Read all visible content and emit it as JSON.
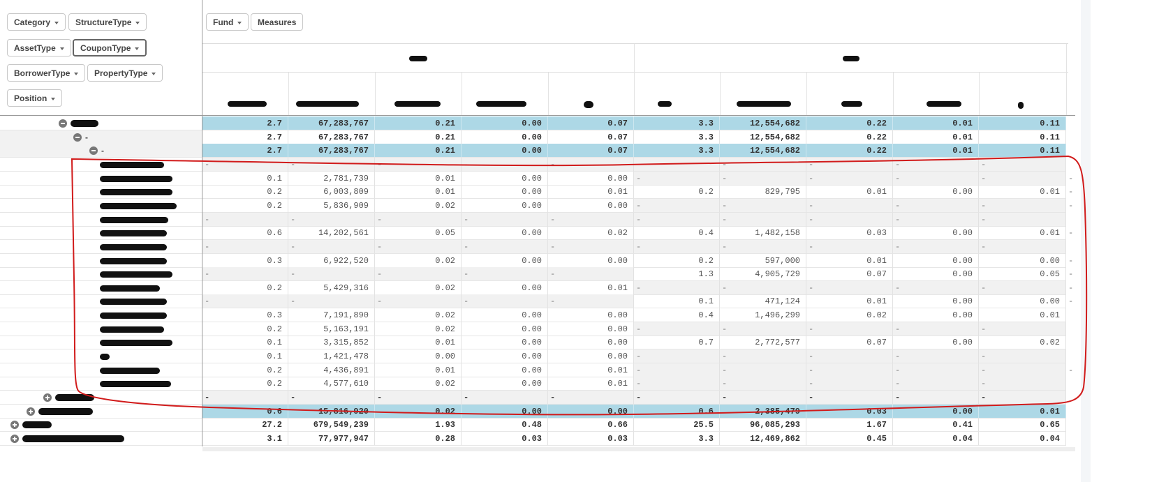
{
  "dimension_chips": [
    {
      "label": "Category"
    },
    {
      "label": "StructureType"
    },
    {
      "label": "AssetType"
    },
    {
      "label": "CouponType",
      "active": true
    },
    {
      "label": "BorrowerType"
    },
    {
      "label": "PropertyType"
    },
    {
      "label": "Position"
    }
  ],
  "column_chips": [
    {
      "label": "Fund",
      "dropdown": true
    },
    {
      "label": "Measures",
      "dropdown": false
    }
  ],
  "colors": {
    "highlight_row": "#add8e6",
    "null_cell": "#f1f1f1",
    "annotation": "#d11b1b"
  },
  "rows": [
    {
      "level": 1,
      "icon": "minus",
      "label": "",
      "style": "hl bold",
      "a": [
        "2.7",
        "67,283,767",
        "0.21",
        "0.00",
        "0.07"
      ],
      "b": [
        "3.3",
        "12,554,682",
        "0.22",
        "0.01",
        "0.11"
      ]
    },
    {
      "level": 2,
      "icon": "minus",
      "label": "-",
      "style": "bold",
      "a": [
        "2.7",
        "67,283,767",
        "0.21",
        "0.00",
        "0.07"
      ],
      "b": [
        "3.3",
        "12,554,682",
        "0.22",
        "0.01",
        "0.11"
      ]
    },
    {
      "level": 3,
      "icon": "minus",
      "label": "-",
      "style": "hl bold",
      "a": [
        "2.7",
        "67,283,767",
        "0.21",
        "0.00",
        "0.07"
      ],
      "b": [
        "3.3",
        "12,554,682",
        "0.22",
        "0.01",
        "0.11"
      ]
    },
    {
      "level": 4,
      "label": "",
      "a": null,
      "b": null,
      "extra": ""
    },
    {
      "level": 4,
      "label": "",
      "a": [
        "0.1",
        "2,781,739",
        "0.01",
        "0.00",
        "0.00"
      ],
      "b": null,
      "extra": "-"
    },
    {
      "level": 4,
      "label": "",
      "a": [
        "0.2",
        "6,003,809",
        "0.01",
        "0.00",
        "0.01"
      ],
      "b": [
        "0.2",
        "829,795",
        "0.01",
        "0.00",
        "0.01"
      ],
      "extra": "-"
    },
    {
      "level": 4,
      "label": "",
      "a": [
        "0.2",
        "5,836,909",
        "0.02",
        "0.00",
        "0.00"
      ],
      "b": null,
      "extra": "-"
    },
    {
      "level": 4,
      "label": "",
      "a": null,
      "b": null,
      "extra": ""
    },
    {
      "level": 4,
      "label": "",
      "a": [
        "0.6",
        "14,202,561",
        "0.05",
        "0.00",
        "0.02"
      ],
      "b": [
        "0.4",
        "1,482,158",
        "0.03",
        "0.00",
        "0.01"
      ],
      "extra": "-"
    },
    {
      "level": 4,
      "label": "",
      "a": null,
      "b": null,
      "extra": ""
    },
    {
      "level": 4,
      "label": "",
      "a": [
        "0.3",
        "6,922,520",
        "0.02",
        "0.00",
        "0.00"
      ],
      "b": [
        "0.2",
        "597,000",
        "0.01",
        "0.00",
        "0.00"
      ],
      "extra": "-"
    },
    {
      "level": 4,
      "label": "",
      "a": null,
      "b": [
        "1.3",
        "4,905,729",
        "0.07",
        "0.00",
        "0.05"
      ],
      "extra": "-"
    },
    {
      "level": 4,
      "label": "",
      "a": [
        "0.2",
        "5,429,316",
        "0.02",
        "0.00",
        "0.01"
      ],
      "b": null,
      "extra": "-"
    },
    {
      "level": 4,
      "label": "",
      "a": null,
      "b": [
        "0.1",
        "471,124",
        "0.01",
        "0.00",
        "0.00"
      ],
      "extra": "-"
    },
    {
      "level": 4,
      "label": "",
      "a": [
        "0.3",
        "7,191,890",
        "0.02",
        "0.00",
        "0.00"
      ],
      "b": [
        "0.4",
        "1,496,299",
        "0.02",
        "0.00",
        "0.01"
      ],
      "extra": ""
    },
    {
      "level": 4,
      "label": "",
      "a": [
        "0.2",
        "5,163,191",
        "0.02",
        "0.00",
        "0.00"
      ],
      "b": null,
      "extra": ""
    },
    {
      "level": 4,
      "label": "",
      "a": [
        "0.1",
        "3,315,852",
        "0.01",
        "0.00",
        "0.00"
      ],
      "b": [
        "0.7",
        "2,772,577",
        "0.07",
        "0.00",
        "0.02"
      ],
      "extra": ""
    },
    {
      "level": 4,
      "label": "",
      "a": [
        "0.1",
        "1,421,478",
        "0.00",
        "0.00",
        "0.00"
      ],
      "b": null,
      "extra": ""
    },
    {
      "level": 4,
      "label": "",
      "a": [
        "0.2",
        "4,436,891",
        "0.01",
        "0.00",
        "0.01"
      ],
      "b": null,
      "extra": "-"
    },
    {
      "level": 4,
      "label": "",
      "a": [
        "0.2",
        "4,577,610",
        "0.02",
        "0.00",
        "0.01"
      ],
      "b": null,
      "extra": ""
    },
    {
      "level": 3,
      "icon": "plus",
      "label": "",
      "style": "bold",
      "a": null,
      "b": null
    },
    {
      "level": 2,
      "icon": "plus",
      "label": "",
      "style": "hl bold",
      "a": [
        "0.6",
        "15,816,920",
        "0.02",
        "0.00",
        "0.00"
      ],
      "b": [
        "0.6",
        "2,385,479",
        "0.03",
        "0.00",
        "0.01"
      ]
    },
    {
      "level": 1,
      "icon": "plus",
      "label": "",
      "style": "bold",
      "a": [
        "27.2",
        "679,549,239",
        "1.93",
        "0.48",
        "0.66"
      ],
      "b": [
        "25.5",
        "96,085,293",
        "1.67",
        "0.41",
        "0.65"
      ]
    },
    {
      "level": 1,
      "icon": "plus",
      "label": "",
      "style": "bold",
      "a": [
        "3.1",
        "77,977,947",
        "0.28",
        "0.03",
        "0.03"
      ],
      "b": [
        "3.3",
        "12,469,862",
        "0.45",
        "0.04",
        "0.04"
      ]
    }
  ],
  "null_text": "-"
}
